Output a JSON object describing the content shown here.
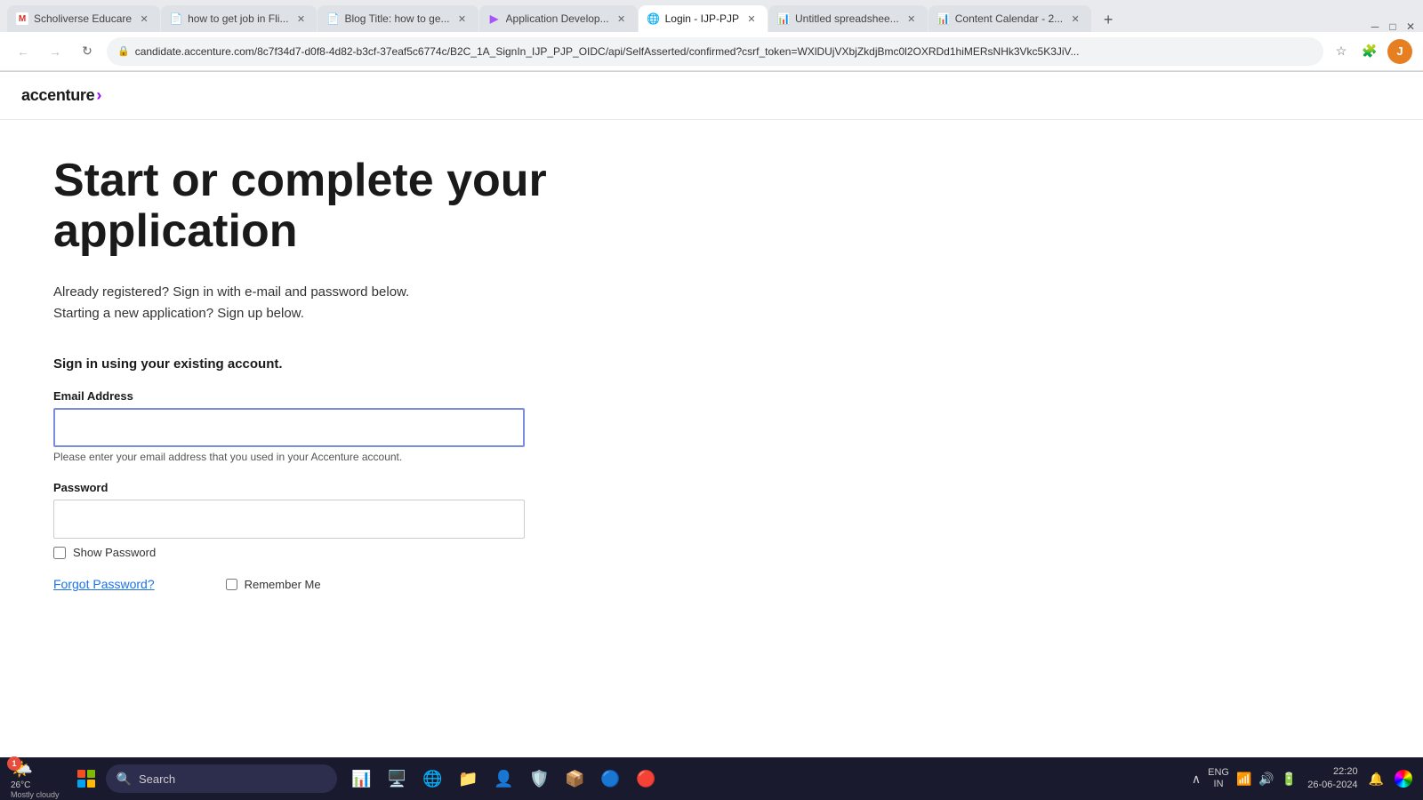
{
  "browser": {
    "tabs": [
      {
        "id": "tab1",
        "label": "Scholiverse Educare",
        "favicon": "M",
        "favicon_color": "#d93025",
        "active": false,
        "closable": true
      },
      {
        "id": "tab2",
        "label": "how to get job in Fli...",
        "favicon": "📄",
        "favicon_color": "#4285f4",
        "active": false,
        "closable": true
      },
      {
        "id": "tab3",
        "label": "Blog Title: how to ge...",
        "favicon": "📄",
        "favicon_color": "#4285f4",
        "active": false,
        "closable": true
      },
      {
        "id": "tab4",
        "label": "Application Develop...",
        "favicon": "▶",
        "favicon_color": "#a855f7",
        "active": false,
        "closable": true
      },
      {
        "id": "tab5",
        "label": "Login - IJP-PJP",
        "favicon": "🌐",
        "favicon_color": "#555",
        "active": true,
        "closable": true
      },
      {
        "id": "tab6",
        "label": "Untitled spreadshee...",
        "favicon": "🟩",
        "favicon_color": "#0f9d58",
        "active": false,
        "closable": true
      },
      {
        "id": "tab7",
        "label": "Content Calendar - 2...",
        "favicon": "🟩",
        "favicon_color": "#0f9d58",
        "active": false,
        "closable": true
      }
    ],
    "url": "candidate.accenture.com/8c7f34d7-d0f8-4d82-b3cf-37eaf5c6774c/B2C_1A_SignIn_IJP_PJP_OIDC/api/SelfAsserted/confirmed?csrf_token=WXlDUjVXbjZkdjBmc0l2OXRDd1hiMERsNHk3Vkc5K3JiV...",
    "secure_icon": "🔒",
    "profile_letter": "J"
  },
  "accenture": {
    "logo_text": "accenture",
    "logo_arrow": "›"
  },
  "page": {
    "title": "Start or complete your application",
    "subtitle_line1": "Already registered? Sign in with e-mail and password below.",
    "subtitle_line2": "Starting a new application? Sign up below.",
    "signin_label": "Sign in using your existing account.",
    "email_label": "Email Address",
    "email_placeholder": "",
    "email_hint": "Please enter your email address that you used in your Accenture account.",
    "password_label": "Password",
    "password_placeholder": "",
    "show_password_label": "Show Password",
    "forgot_password_label": "Forgot Password?",
    "remember_me_label": "Remember Me"
  },
  "taskbar": {
    "weather_badge": "1",
    "weather_temp": "26°C",
    "weather_desc": "Mostly cloudy",
    "search_placeholder": "Search",
    "lang_line1": "ENG",
    "lang_line2": "IN",
    "time": "22:20",
    "date": "26-06-2024",
    "apps": [
      "🪟",
      "📊",
      "🖥️",
      "🌐",
      "📁",
      "👤",
      "🛡️",
      "📦",
      "🔵",
      "🔴"
    ]
  }
}
